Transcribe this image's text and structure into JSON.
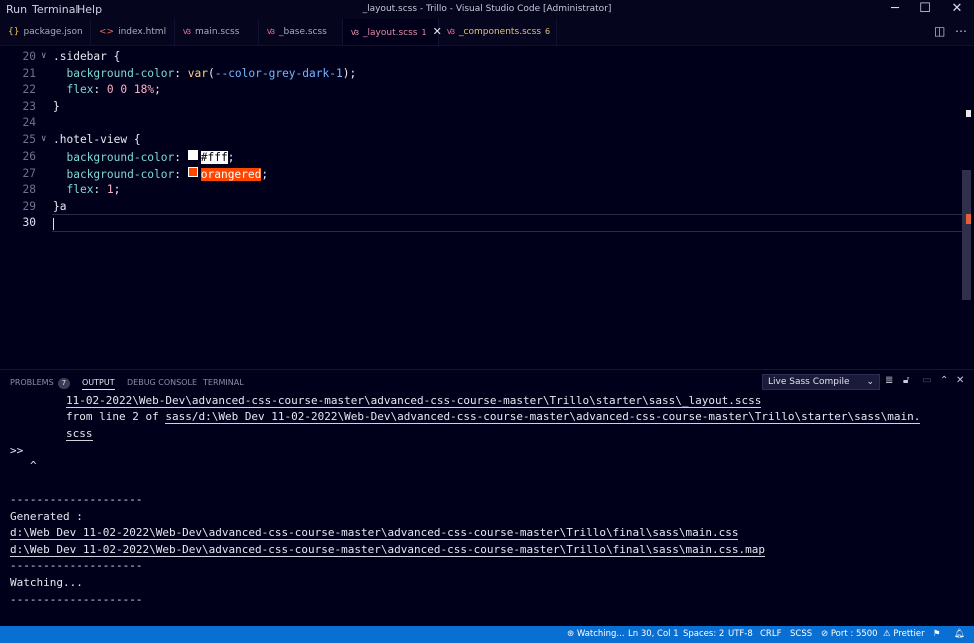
{
  "titlebar": {
    "menu": [
      "Run",
      "Terminal",
      "Help"
    ],
    "title": "_layout.scss - Trillo - Visual Studio Code [Administrator]",
    "buttons": [
      "─",
      "☐",
      "✕"
    ]
  },
  "tabs": [
    {
      "icon": "{}",
      "label": "package.json",
      "badge": "",
      "state": "normal"
    },
    {
      "icon": "<>",
      "label": "index.html",
      "badge": "",
      "state": "normal"
    },
    {
      "icon": "ꟃ",
      "label": "main.scss",
      "badge": "",
      "state": "normal"
    },
    {
      "icon": "ꟃ",
      "label": "_base.scss",
      "badge": "",
      "state": "normal"
    },
    {
      "icon": "ꟃ",
      "label": "_layout.scss",
      "badge": "1",
      "state": "active"
    },
    {
      "icon": "ꟃ",
      "label": "_components.scss",
      "badge": "6",
      "state": "warn"
    }
  ],
  "editor": {
    "lines": [
      {
        "n": "20",
        "fold": "∨"
      },
      {
        "n": "21"
      },
      {
        "n": "22"
      },
      {
        "n": "23"
      },
      {
        "n": "24"
      },
      {
        "n": "25",
        "fold": "∨"
      },
      {
        "n": "26"
      },
      {
        "n": "27"
      },
      {
        "n": "28"
      },
      {
        "n": "29"
      },
      {
        "n": "30"
      }
    ],
    "code": {
      "l20": ".sidebar {",
      "l21_prop": "background-color",
      "l21_fn": "var",
      "l21_var": "--color-grey-dark-1",
      "l22_prop": "flex",
      "l22_val": "0 0 18%",
      "l23": "}",
      "l25": ".hotel-view {",
      "l26_prop": "background-color",
      "l26_val": "#fff",
      "l27_prop": "background-color",
      "l27_val": "orangered",
      "l28_prop": "flex",
      "l28_val": "1",
      "l29": "}a"
    },
    "swatch_colors": {
      "white": "#ffffff",
      "orangered": "#ff4500"
    }
  },
  "panel": {
    "tabs": [
      {
        "label": "PROBLEMS",
        "badge": "7"
      },
      {
        "label": "OUTPUT",
        "badge": ""
      },
      {
        "label": "DEBUG CONSOLE",
        "badge": ""
      },
      {
        "label": "TERMINAL",
        "badge": ""
      }
    ],
    "active_tab": "OUTPUT",
    "output_channel": "Live Sass Compile",
    "output": {
      "l1": "11-02-2022\\Web-Dev\\advanced-css-course-master\\advanced-css-course-master\\Trillo\\starter\\sass\\_layout.scss",
      "l2a": "from line 2 of ",
      "l2b": "sass/d:\\Web Dev 11-02-2022\\Web-Dev\\advanced-css-course-master\\advanced-css-course-master\\Trillo\\starter\\sass\\main.",
      "l3": "scss",
      "l4": ">>",
      "l5": "^",
      "l6": "--------------------",
      "l7": "Generated :",
      "l8": "d:\\Web Dev 11-02-2022\\Web-Dev\\advanced-css-course-master\\advanced-css-course-master\\Trillo\\final\\sass\\main.css",
      "l9": "d:\\Web Dev 11-02-2022\\Web-Dev\\advanced-css-course-master\\advanced-css-course-master\\Trillo\\final\\sass\\main.css.map",
      "l10": "--------------------",
      "l11": "Watching...",
      "l12": "--------------------"
    }
  },
  "statusbar": {
    "watching": "Watching...",
    "position": "Ln 30, Col 1",
    "spaces": "Spaces: 2",
    "encoding": "UTF-8",
    "eol": "CRLF",
    "language": "SCSS",
    "port": "Port : 5500",
    "prettier": "Prettier",
    "accent": "#0a6fd3"
  }
}
